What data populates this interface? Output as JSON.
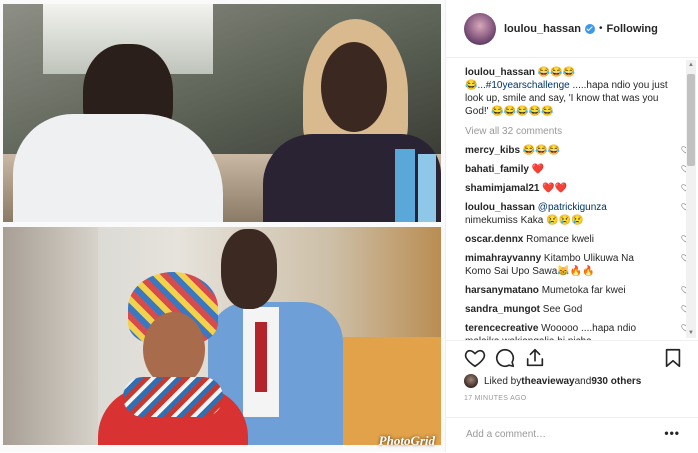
{
  "post": {
    "watermark": "PhotoGrid"
  },
  "header": {
    "username": "loulou_hassan",
    "separator": "•",
    "following_label": "Following"
  },
  "caption": {
    "username": "loulou_hassan",
    "emoji_lead": "😂😂😂",
    "text_part1": "😂...",
    "hashtag": "#10yearschallenge",
    "text_part2": " .....hapa ndio you just look up, smile and say, 'I know that was you God!' 😂😂😂😂😂"
  },
  "view_all": "View all 32 comments",
  "comments": [
    {
      "username": "mercy_kibs",
      "text": " 😂😂😂"
    },
    {
      "username": "bahati_family",
      "text": " ❤️"
    },
    {
      "username": "shamimjamal21",
      "text": " ❤️❤️"
    },
    {
      "username": "loulou_hassan",
      "mention": "@patrickigunza",
      "text": " nimekumiss Kaka 😢😢😢"
    },
    {
      "username": "oscar.dennx",
      "text": " Romance kweli"
    },
    {
      "username": "mimahrayvanny",
      "text": " Kitambo Ulikuwa Na Komo Sai Upo Sawa😹🔥🔥"
    },
    {
      "username": "harsanymatano",
      "text": " Mumetoka far kwei"
    },
    {
      "username": "sandra_mungot",
      "text": " See God"
    },
    {
      "username": "terencecreative",
      "text": " Wooooo ....hapa ndio malaika wakiangalia hi picha"
    }
  ],
  "likes": {
    "prefix": "Liked by ",
    "user": "theavieway",
    "middle": " and ",
    "count": "930 others"
  },
  "timestamp": "17 MINUTES AGO",
  "comment_box": {
    "placeholder": "Add a comment…",
    "more_label": "•••"
  },
  "icons": {
    "like": "heart-icon",
    "comment": "comment-bubble-icon",
    "share": "share-icon",
    "save": "bookmark-icon"
  }
}
